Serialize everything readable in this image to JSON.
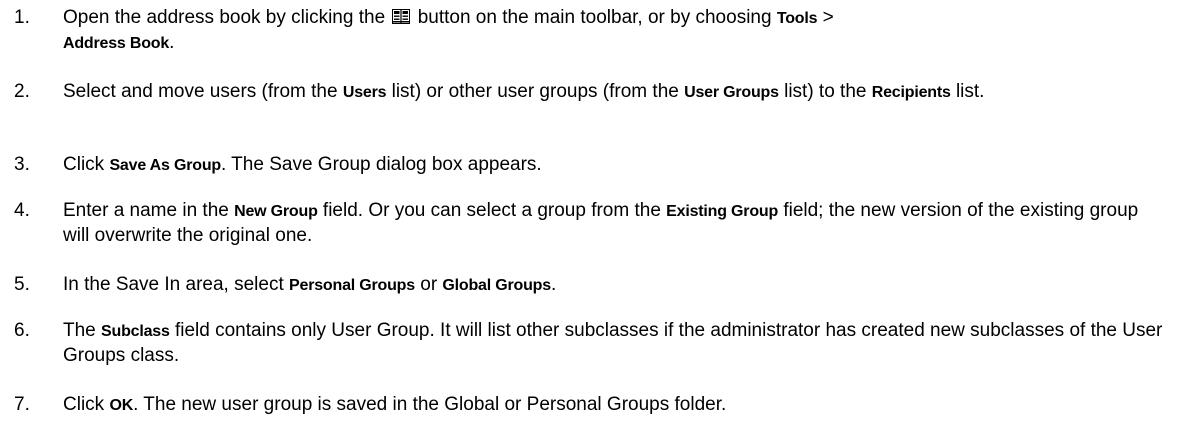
{
  "steps": [
    {
      "number": "1.",
      "seg_a": "Open the address book by clicking the",
      "icon": "address-book-toolbar-icon",
      "seg_b": " button on the main toolbar, or by choosing ",
      "ui_tools": "Tools",
      "seg_c": " >",
      "ui_address_book": "Address Book",
      "seg_d": "."
    },
    {
      "number": "2.",
      "seg_a": "Select and move users (from the ",
      "ui_users": "Users",
      "seg_b": " list) or other user groups (from the ",
      "ui_user_groups": "User Groups",
      "seg_c": " list) to the ",
      "ui_recipients": "Recipients",
      "seg_d": " list."
    },
    {
      "number": "3.",
      "seg_a": "Click ",
      "ui_save_as_group": "Save As Group",
      "seg_b": ". The Save Group dialog box appears."
    },
    {
      "number": "4.",
      "seg_a": "Enter a name in the ",
      "ui_new_group": "New Group",
      "seg_b": " field. Or you can select a group from the ",
      "ui_existing_group": "Existing Group",
      "seg_c": " field; the new version of the existing group will overwrite the original one."
    },
    {
      "number": "5.",
      "seg_a": "In the Save In area, select ",
      "ui_personal_groups": "Personal Groups",
      "seg_b": " or ",
      "ui_global_groups": "Global Groups",
      "seg_c": "."
    },
    {
      "number": "6.",
      "seg_a": "The ",
      "ui_subclass": "Subclass",
      "seg_b": " field contains only User Group. It will list other subclasses if the administrator has created new subclasses of the User Groups class."
    },
    {
      "number": "7.",
      "seg_a": "Click ",
      "ui_ok": "OK",
      "seg_b": ". The new user group is saved in the Global or Personal Groups folder."
    }
  ],
  "colors": {
    "text": "#000000",
    "background": "#ffffff"
  }
}
